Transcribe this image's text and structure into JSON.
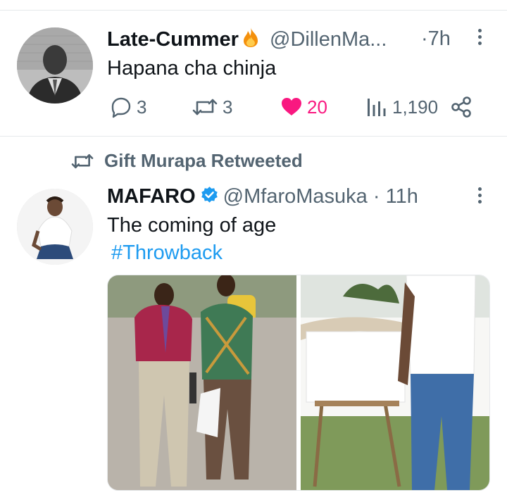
{
  "tweet1": {
    "display_name": "Late-Cummer",
    "name_emoji_icon": "fire-icon",
    "handle": "@DillenMa...",
    "separator": "·",
    "time": "7h",
    "text": "Hapana cha chinja",
    "replies": "3",
    "retweets": "3",
    "likes": "20",
    "views": "1,190"
  },
  "retweet_banner": {
    "label": "Gift Murapa Retweeted"
  },
  "tweet2": {
    "display_name": "MAFARO",
    "handle": "@MfaroMasuka",
    "separator": "·",
    "time": "11h",
    "text": "The coming of age",
    "hashtag": "#Throwback"
  },
  "colors": {
    "like": "#f91880",
    "link": "#1d9bf0",
    "secondary": "#536471",
    "verified": "#1d9bf0"
  }
}
